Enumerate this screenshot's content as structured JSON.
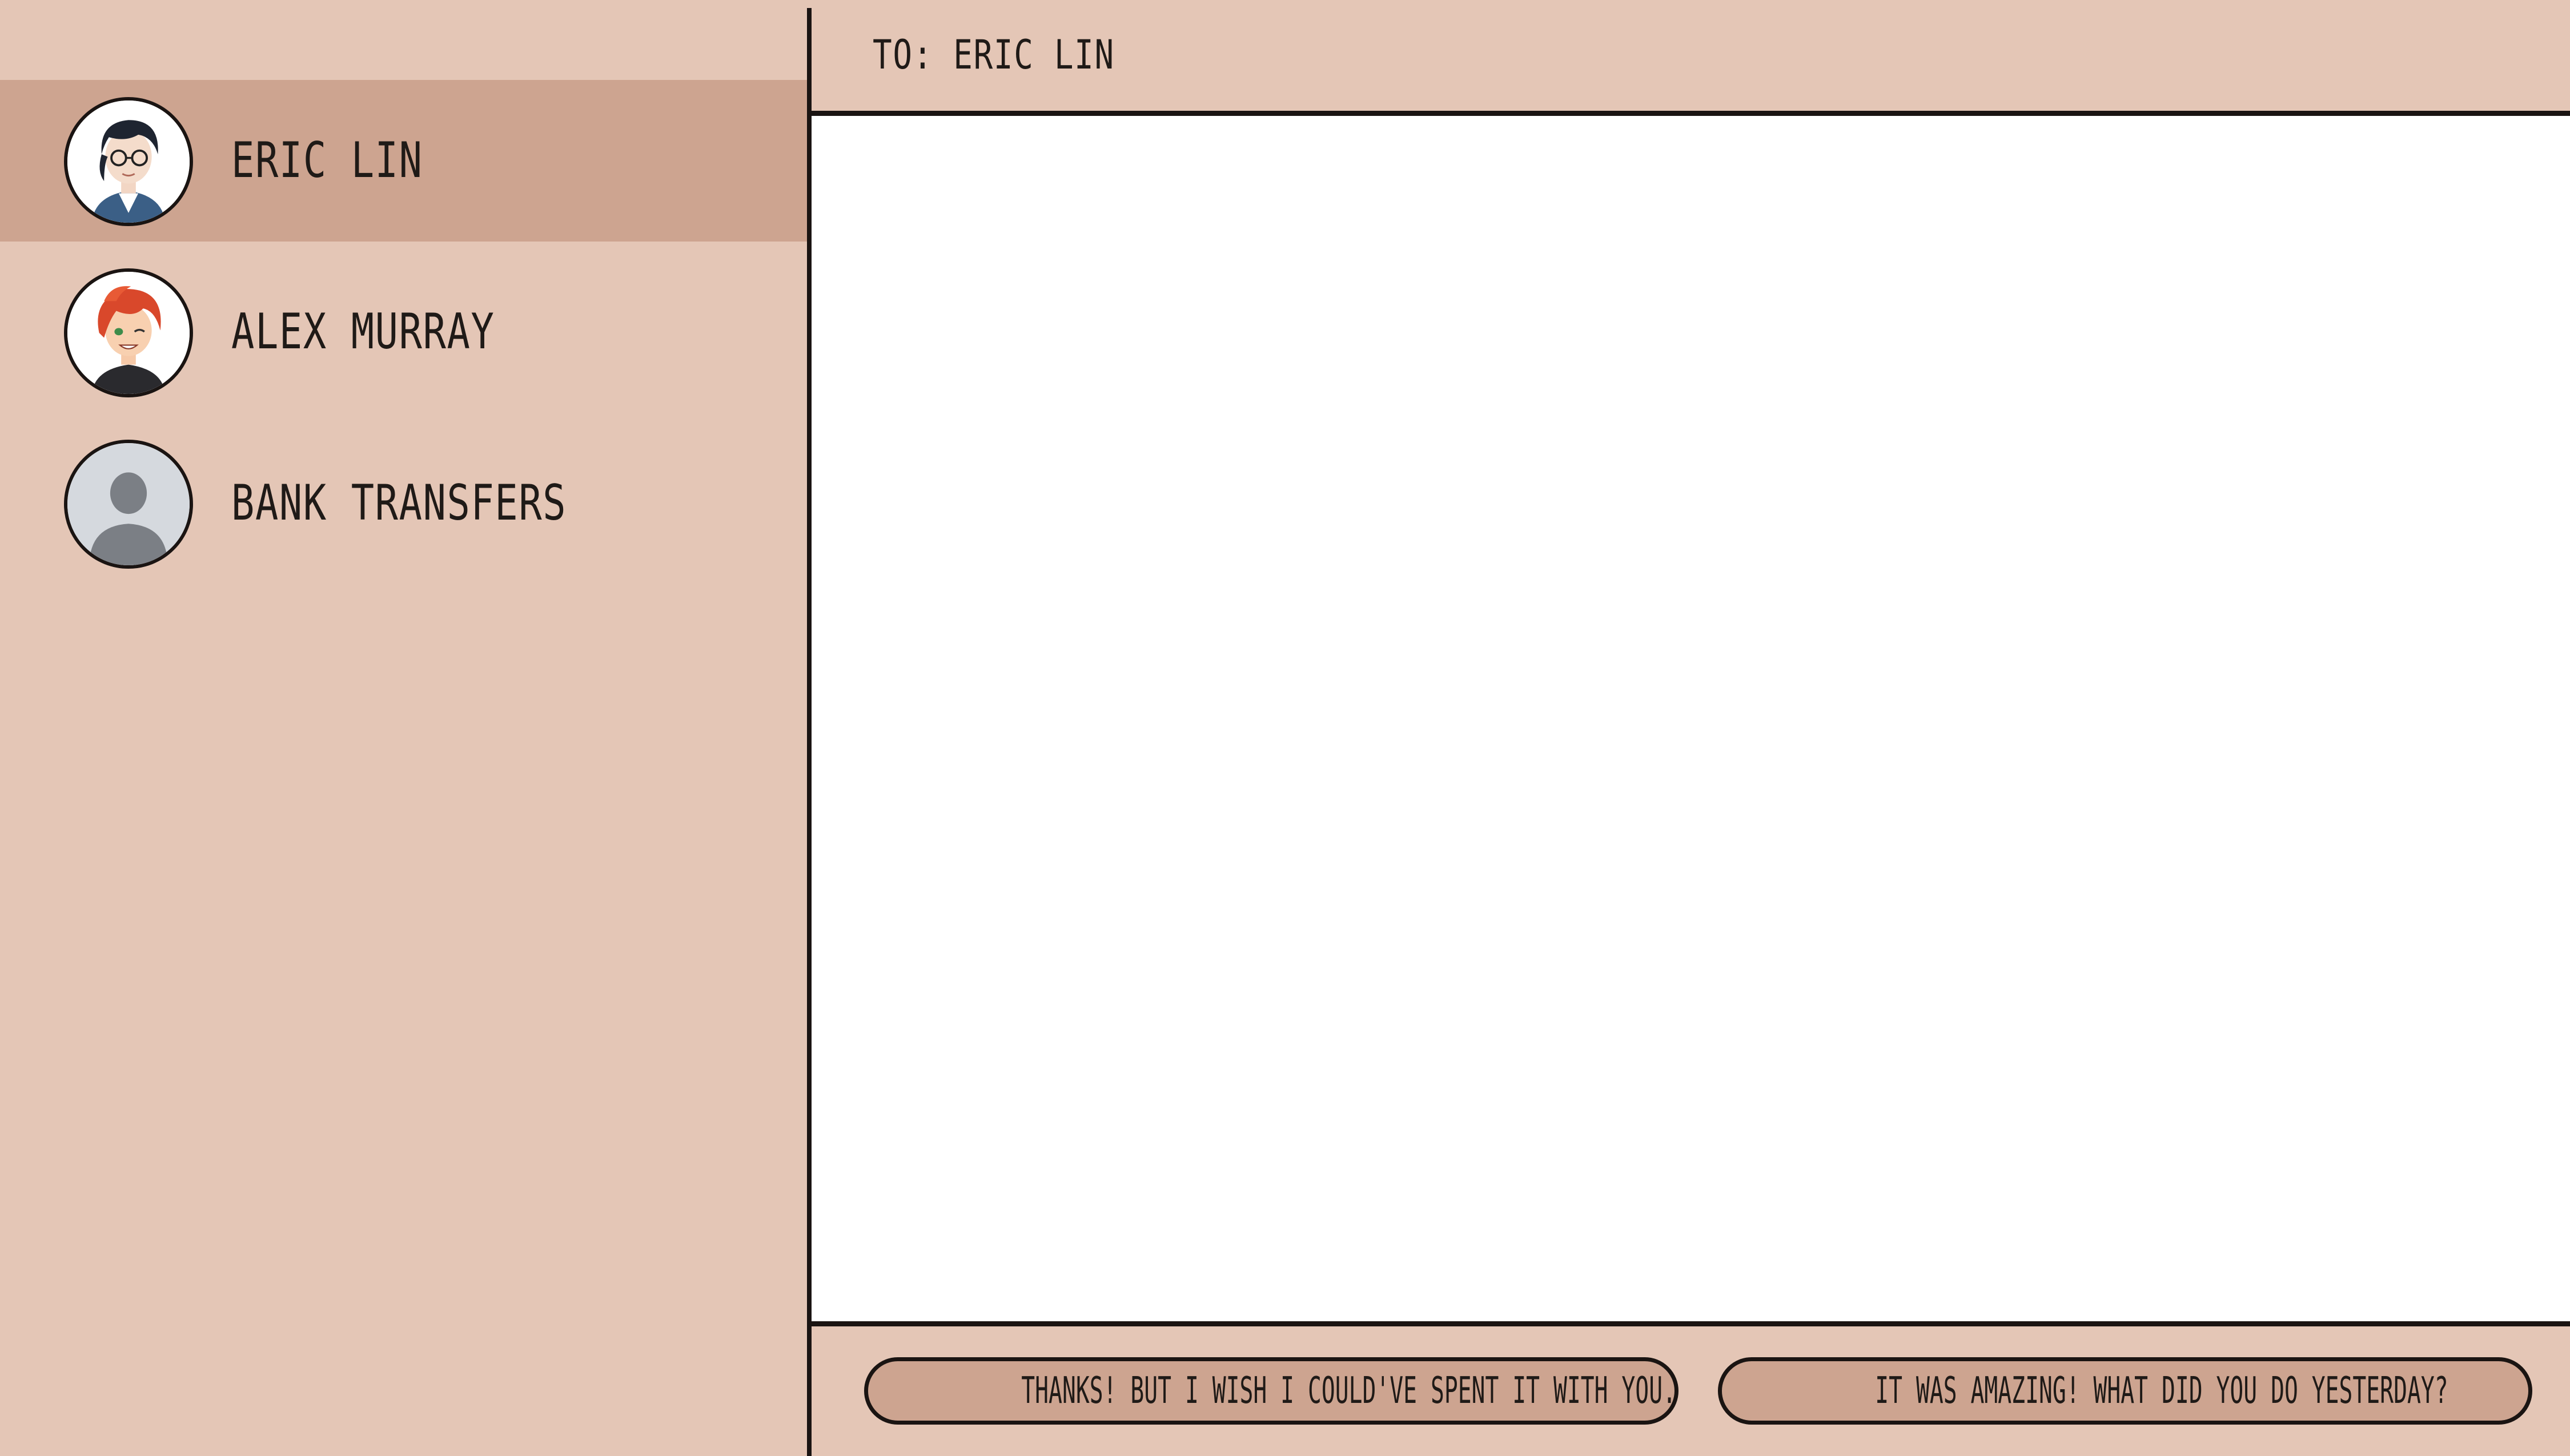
{
  "contacts": [
    {
      "name": "ERIC LIN",
      "active": true,
      "avatar_icon": "character-portrait-dark-hair-glasses"
    },
    {
      "name": "ALEX MURRAY",
      "active": false,
      "avatar_icon": "character-portrait-red-hair"
    },
    {
      "name": "BANK TRANSFERS",
      "active": false,
      "avatar_icon": "default-user-silhouette"
    }
  ],
  "header": {
    "to_label": "TO: ERIC LIN"
  },
  "replies": [
    {
      "label": "THANKS! BUT I WISH I COULD'VE SPENT IT WITH YOU..."
    },
    {
      "label": "IT WAS AMAZING! WHAT DID YOU DO YESTERDAY?"
    }
  ],
  "colors": {
    "background": "#e4c6b6",
    "active_row": "#cda490",
    "button_fill": "#cda490",
    "ink": "#1a1412",
    "chat_background": "#ffffff"
  }
}
